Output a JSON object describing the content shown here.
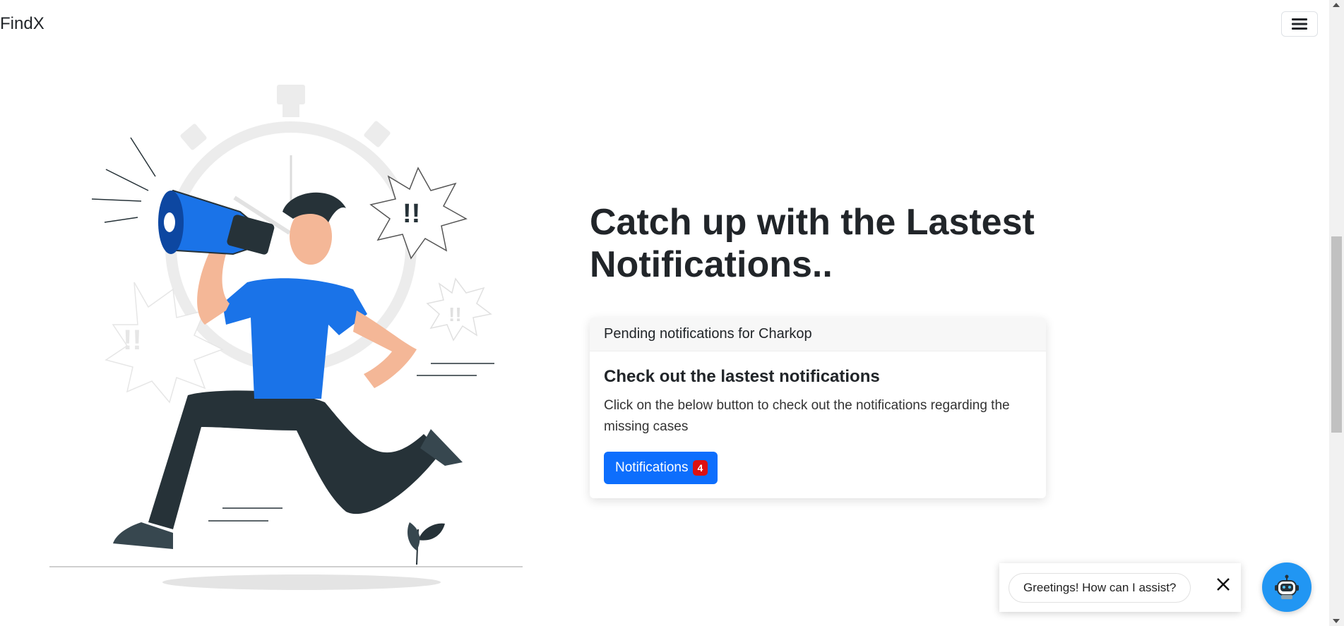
{
  "navbar": {
    "brand": "FindX",
    "menu_icon": "hamburger-menu-icon"
  },
  "hero": {
    "title": "Catch up with the Lastest Notifications..",
    "illustration": "man-running-with-megaphone-illustration",
    "illustration_marks": [
      "!!",
      "!!",
      "!!"
    ]
  },
  "card": {
    "header": "Pending notifications for Charkop",
    "title": "Check out the lastest notifications",
    "text": "Click on the below button to check out the notifications regarding the missing cases",
    "button_label": "Notifications",
    "badge_count": "4"
  },
  "chat": {
    "greeting": "Greetings! How can I assist?",
    "close_icon": "close-icon",
    "launcher_icon": "chatbot-robot-icon"
  },
  "colors": {
    "primary": "#0d6efd",
    "badge": "#dc1010",
    "chat_launcher": "#2196f3",
    "text": "#212529"
  }
}
